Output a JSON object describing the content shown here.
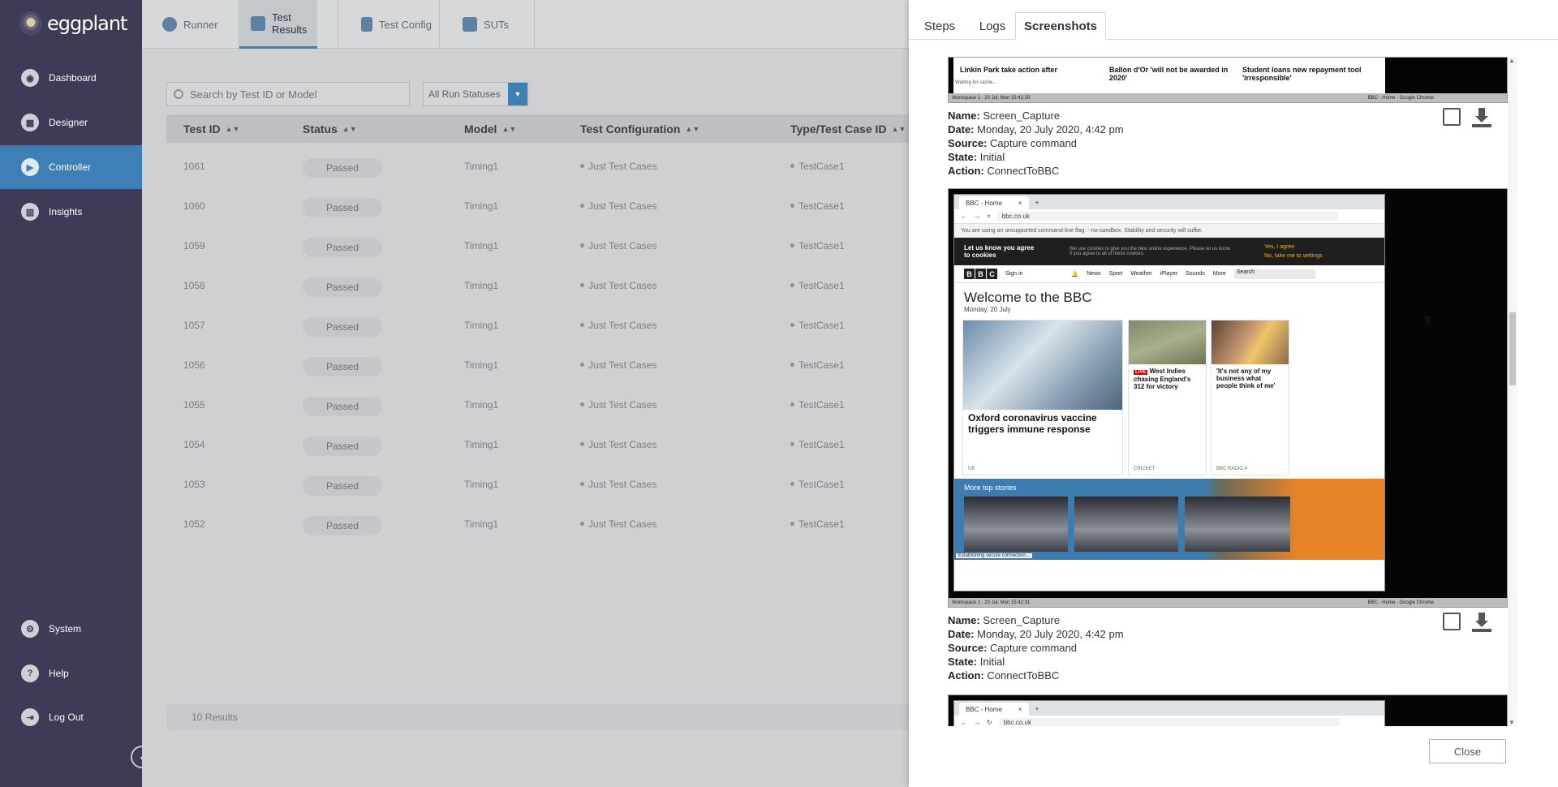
{
  "brand": {
    "name": "eggplant"
  },
  "sidebar": {
    "items": [
      {
        "label": "Dashboard",
        "icon": "dashboard-icon"
      },
      {
        "label": "Designer",
        "icon": "designer-icon"
      },
      {
        "label": "Controller",
        "icon": "controller-icon",
        "active": true
      },
      {
        "label": "Insights",
        "icon": "insights-icon"
      },
      {
        "label": "System",
        "icon": "system-icon"
      },
      {
        "label": "Help",
        "icon": "help-icon"
      },
      {
        "label": "Log Out",
        "icon": "logout-icon"
      }
    ]
  },
  "topnav": {
    "tabs": [
      {
        "label": "Runner"
      },
      {
        "label": "Test Results",
        "active": true
      },
      {
        "label": "Test Config"
      },
      {
        "label": "SUTs"
      }
    ]
  },
  "filters": {
    "search_placeholder": "Search by Test ID or Model",
    "status_value": "All Run Statuses"
  },
  "table": {
    "headers": [
      "Test ID",
      "Status",
      "Model",
      "Test Configuration",
      "Type/Test Case ID"
    ],
    "rows": [
      {
        "id": "1061",
        "status": "Passed",
        "model": "Timing1",
        "config": "Just Test Cases",
        "type": "TestCase1"
      },
      {
        "id": "1060",
        "status": "Passed",
        "model": "Timing1",
        "config": "Just Test Cases",
        "type": "TestCase1"
      },
      {
        "id": "1059",
        "status": "Passed",
        "model": "Timing1",
        "config": "Just Test Cases",
        "type": "TestCase1"
      },
      {
        "id": "1058",
        "status": "Passed",
        "model": "Timing1",
        "config": "Just Test Cases",
        "type": "TestCase1"
      },
      {
        "id": "1057",
        "status": "Passed",
        "model": "Timing1",
        "config": "Just Test Cases",
        "type": "TestCase1"
      },
      {
        "id": "1056",
        "status": "Passed",
        "model": "Timing1",
        "config": "Just Test Cases",
        "type": "TestCase1"
      },
      {
        "id": "1055",
        "status": "Passed",
        "model": "Timing1",
        "config": "Just Test Cases",
        "type": "TestCase1"
      },
      {
        "id": "1054",
        "status": "Passed",
        "model": "Timing1",
        "config": "Just Test Cases",
        "type": "TestCase1"
      },
      {
        "id": "1053",
        "status": "Passed",
        "model": "Timing1",
        "config": "Just Test Cases",
        "type": "TestCase1"
      },
      {
        "id": "1052",
        "status": "Passed",
        "model": "Timing1",
        "config": "Just Test Cases",
        "type": "TestCase1"
      }
    ],
    "footer": "10 Results"
  },
  "panel": {
    "tabs": [
      "Steps",
      "Logs",
      "Screenshots"
    ],
    "active_tab": "Screenshots",
    "close_label": "Close",
    "meta_labels": {
      "name": "Name:",
      "date": "Date:",
      "source": "Source:",
      "state": "State:",
      "action": "Action:"
    },
    "screenshots": [
      {
        "name": "Screen_Capture",
        "date": "Monday, 20 July 2020, 4:42 pm",
        "source": "Capture command",
        "state": "Initial",
        "action": "ConnectToBBC",
        "headlines": [
          "Linkin Park take action after",
          "Ballon d'Or 'will not be awarded in 2020'",
          "Student loans new repayment tool 'irresponsible'"
        ],
        "status_text": "Waiting for cache...",
        "taskbar_left": "Workspace 1",
        "taskbar_time": "20 Jul, Mon 15:42:29",
        "taskbar_right": "BBC - Home - Google Chrome"
      },
      {
        "name": "Screen_Capture",
        "date": "Monday, 20 July 2020, 4:42 pm",
        "source": "Capture command",
        "state": "Initial",
        "action": "ConnectToBBC",
        "tab_title": "BBC - Home",
        "url": "bbc.co.uk",
        "warning": "You are using an unsupported command-line flag: --no-sandbox. Stability and security will suffer.",
        "cookie_title": "Let us know you agree to cookies",
        "cookie_msg": "We use cookies to give you the best online experience. Please let us know if you agree to all of these cookies.",
        "cookie_yes": "Yes, I agree",
        "cookie_no": "No, take me to settings",
        "sign_in": "Sign in",
        "nav": [
          "News",
          "Sport",
          "Weather",
          "iPlayer",
          "Sounds",
          "More"
        ],
        "search": "Search",
        "welcome": "Welcome to the BBC",
        "welcome_date": "Monday, 20 July",
        "stories": [
          {
            "title": "Oxford coronavirus vaccine triggers immune response",
            "tag": "UK"
          },
          {
            "title": "West Indies chasing England's 312 for victory",
            "tag": "CRICKET",
            "badge": "LIVE"
          },
          {
            "title": "'It's not any of my business what people think of me'",
            "tag": "BBC RADIO 4"
          }
        ],
        "more_label": "More top stories",
        "status_text": "Establishing secure connection...",
        "taskbar_left": "Workspace 1",
        "taskbar_time": "20 Jul, Mon 15:42:31",
        "taskbar_right": "BBC - Home - Google Chrome"
      },
      {
        "tab_title": "BBC - Home",
        "url": "bbc.co.uk"
      }
    ]
  },
  "colors": {
    "sidebar_bg": "#3f3a55",
    "accent": "#3e7fb6"
  }
}
